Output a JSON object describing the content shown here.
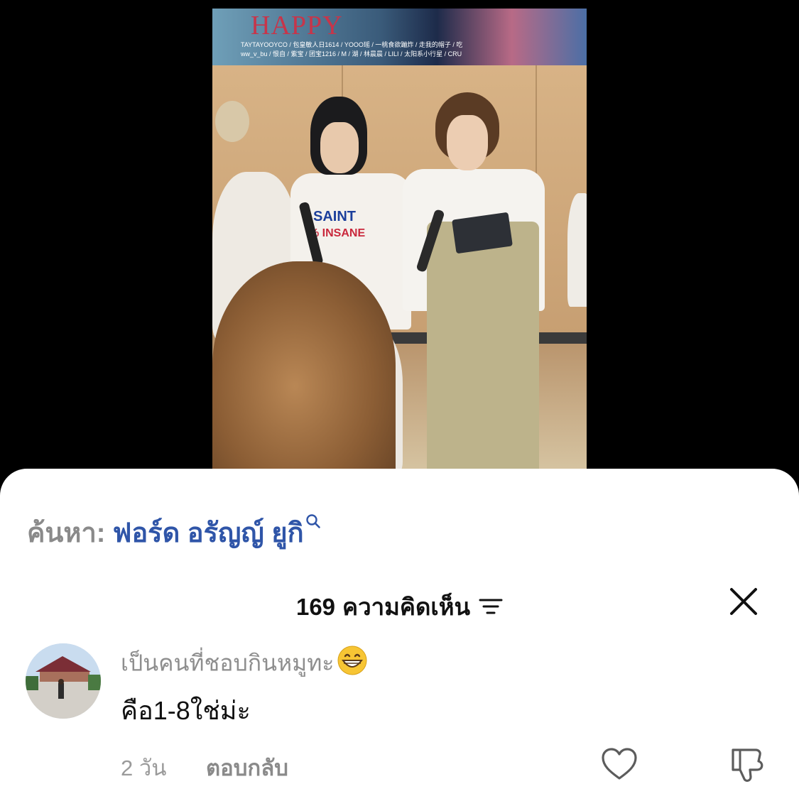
{
  "video": {
    "banner_title": "HAPPY",
    "banner_names_row1": "TAYTAYOOYCO / 包皇敏人日1614 / YOOO瑶 / 一桃食欲蹦炸 / 走我的帽子 / 吃",
    "banner_names_row2": "ww_v_bu / 恨自 / 紫宝 / 团宝1216 / M / 湖 / 林晨晨 / LILI / 太阳系小行星 / CRU",
    "shirt_print_line1": "SAINT",
    "shirt_print_line2": "% INSANE"
  },
  "search": {
    "prefix": "ค้นหา:",
    "term": "ฟอร์ด อรัญญ์ ยูกิ"
  },
  "comments_header": {
    "count": "169",
    "label": "ความคิดเห็น"
  },
  "comment": {
    "username": "เป็นคนที่ชอบกินหมูทะ",
    "text": "คือ1-8ใช่ม่ะ",
    "time": "2 วัน",
    "reply_label": "ตอบกลับ"
  },
  "colors": {
    "search_term": "#2f55a8",
    "sheet_bg": "#ffffff",
    "screen_bg": "#000000"
  },
  "icons": {
    "search": "search-icon",
    "filter": "filter-icon",
    "close": "close-icon",
    "like": "heart-icon",
    "dislike": "thumbs-down-icon",
    "emoji": "grinning-face-icon"
  }
}
